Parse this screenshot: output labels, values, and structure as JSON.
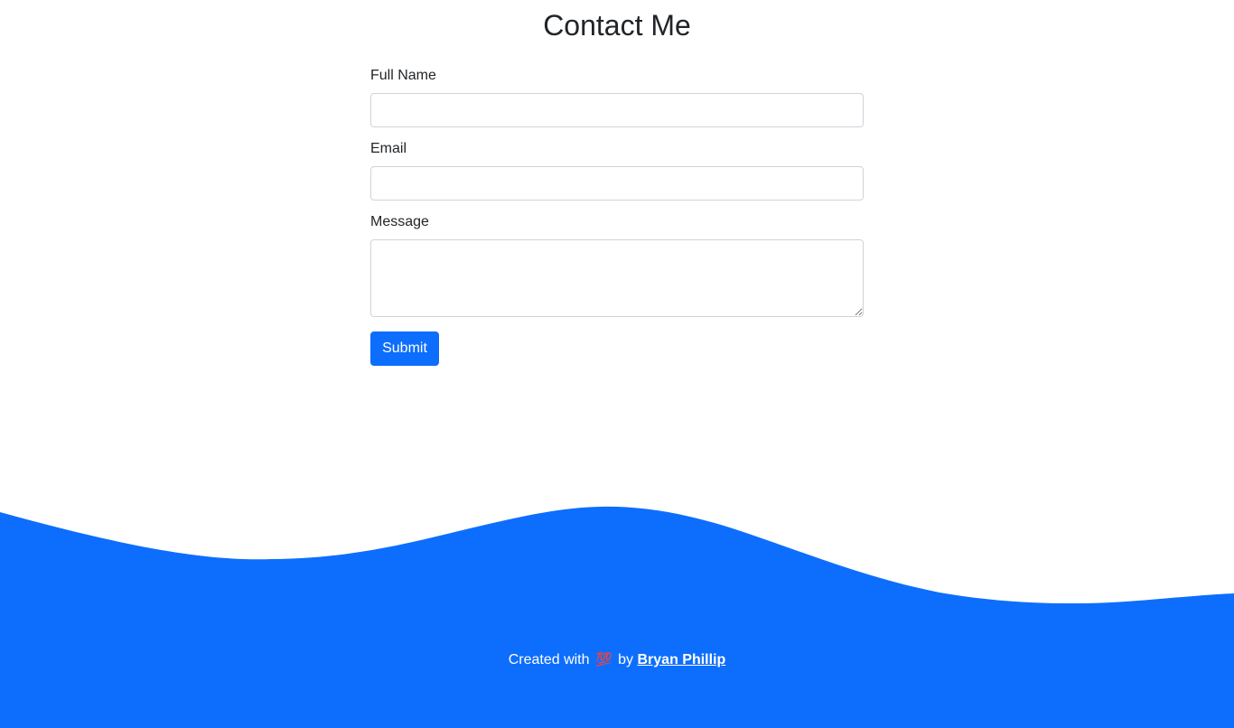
{
  "header": {
    "title": "Contact Me"
  },
  "form": {
    "full_name": {
      "label": "Full Name",
      "value": "",
      "placeholder": ""
    },
    "email": {
      "label": "Email",
      "value": "",
      "placeholder": ""
    },
    "message": {
      "label": "Message",
      "value": "",
      "placeholder": ""
    },
    "submit_label": "Submit"
  },
  "footer": {
    "prefix": "Created with",
    "heart_glyph": "💯",
    "heart_icon": "heart-icon",
    "by": "by",
    "author": "Bryan Phillip"
  },
  "colors": {
    "accent": "#0d6efd",
    "background": "#ffffff",
    "text": "#212529",
    "footer_text": "#ffffff"
  }
}
